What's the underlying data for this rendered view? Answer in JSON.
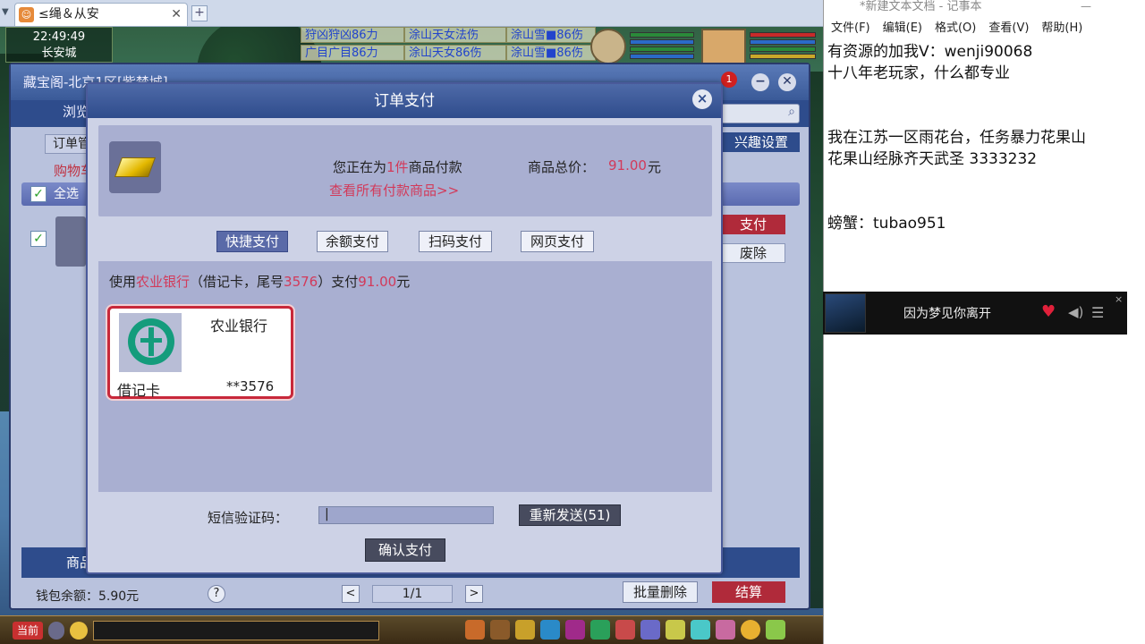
{
  "browser": {
    "tab_title": "≤绳＆从安",
    "tab_icon": "game-avatar-icon"
  },
  "hud": {
    "time": "22:49:49",
    "location": "长安城",
    "chat_rows": [
      "狩凶狩凶86力",
      "涂山天女法伤",
      "涂山雪■86伤",
      "广目广目86力",
      "涂山天女86伤",
      "涂山雪■86伤"
    ]
  },
  "store": {
    "title": "藏宝阁-北京1区[紫禁城]",
    "nav_tab": "浏览",
    "order_tab": "订单管",
    "interest_btn": "兴趣设置",
    "cart_label": "购物车",
    "select_all": "全选",
    "pay_btn": "支付",
    "discard_btn": "废除",
    "bottom_label": "商品",
    "wallet_label": "钱包余额：5.90元",
    "help": "?",
    "page": "1/1",
    "prev": "<",
    "next": ">",
    "batch_delete": "批量删除",
    "checkout": "结算",
    "cart_badge": "1"
  },
  "modal": {
    "title": "订单支付",
    "close": "×",
    "paying_prefix": "您正在为",
    "paying_count": "1件",
    "paying_suffix": "商品付款",
    "total_label": "商品总价：",
    "total_value": "91.00",
    "total_unit": "元",
    "view_all": "查看所有付款商品>>",
    "pay_tabs": [
      "快捷支付",
      "余额支付",
      "扫码支付",
      "网页支付"
    ],
    "active_tab": 0,
    "use_prefix": "使用",
    "use_bank": "农业银行",
    "use_mid": "（借记卡，尾号",
    "use_tail": "3576",
    "use_pay": "）支付",
    "use_amount": "91.00",
    "use_unit": "元",
    "card": {
      "bank": "农业银行",
      "type": "借记卡",
      "number": "**3576",
      "logo_color": "#149c7c"
    },
    "sms_label": "短信验证码：",
    "sms_value": "|",
    "resend": "重新发送(51)",
    "confirm": "确认支付"
  },
  "gamebar": {
    "current": "当前"
  },
  "notepad": {
    "title": "*新建文本文档 - 记事本",
    "menu": [
      "文件(F)",
      "编辑(E)",
      "格式(O)",
      "查看(V)",
      "帮助(H)"
    ],
    "lines": [
      "有资源的加我V：wenji90068",
      "十八年老玩家，什么都专业",
      "",
      "",
      "我在江苏一区雨花台，任务暴力花果山",
      "花果山经脉齐天武圣 3333232",
      "",
      "",
      "螃蟹：tubao951"
    ]
  },
  "music": {
    "title": "因为梦见你离开",
    "close": "×"
  },
  "colors": {
    "accent_red": "#d23a5a",
    "store_blue": "#2e4c8c",
    "abc_green": "#149c7c"
  }
}
